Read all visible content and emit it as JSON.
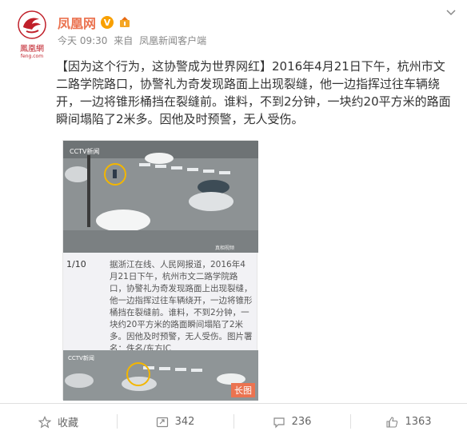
{
  "account": {
    "name": "凤凰网",
    "verified_mark": "V",
    "logo_text": "鳳凰網",
    "logo_url": "feng.com"
  },
  "meta": {
    "time": "今天 09:30",
    "source_prefix": "来自",
    "source": "凤凰新闻客户端"
  },
  "post": {
    "text": "【因为这个行为，这协警成为世界网红】2016年4月21日下午，杭州市文二路学院路口，协警礼为奇发现路面上出现裂缝，他一边指挥过往车辆绕开，一边将锥形桶挡在裂缝前。谁料，不到2分钟，一块约20平方米的路面瞬间塌陷了2米多。因他及时预警，无人受伤。"
  },
  "card": {
    "index": "1/10",
    "caption": "据浙江在线、人民网报道，2016年4月21日下午，杭州市文二路学院路口，协警礼为奇发现路面上出现裂缝，他一边指挥过往车辆绕开，一边将锥形桶挡在裂缝前。谁料，不到2分钟，一块约20平方米的路面瞬间塌陷了2米多。因他及时预警，无人受伤。图片署名：佚名/东方IC",
    "long_badge": "长图",
    "tv_logo": "CCTV新闻",
    "watermark": "真相视频"
  },
  "actions": [
    {
      "icon": "star-icon",
      "label": "收藏"
    },
    {
      "icon": "repost-icon",
      "label": "342"
    },
    {
      "icon": "comment-icon",
      "label": "236"
    },
    {
      "icon": "like-icon",
      "label": "1363"
    }
  ],
  "colors": {
    "brand": "#c0202a",
    "name": "#eb7350",
    "verified": "#f8a000"
  }
}
